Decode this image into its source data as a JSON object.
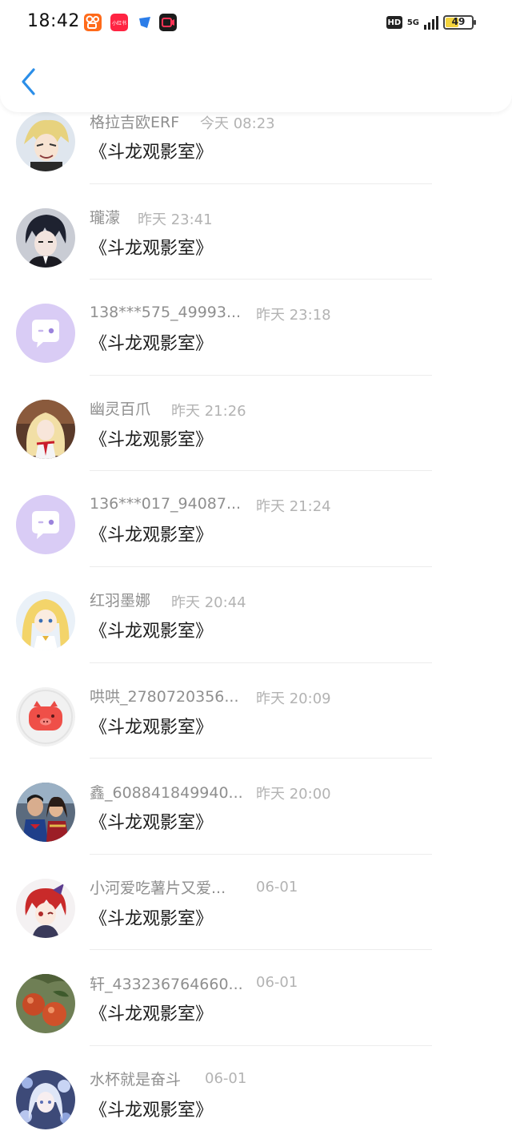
{
  "status_bar": {
    "time": "18:42",
    "network": "5G",
    "hd": "HD",
    "battery": "49",
    "battery_level": 0.49,
    "app_icons": [
      "kuaishou-app-icon",
      "xiaohongshu-app-icon",
      "feishu-app-icon",
      "video-app-icon"
    ],
    "app_badge_text": "小红书"
  },
  "header": {
    "back_icon": "chevron-left-icon",
    "accent_color": "#2b8ee8"
  },
  "messages": [
    {
      "name": "格拉吉欧ERF",
      "time": "今天 08:23",
      "text": "《斗龙观影室》",
      "avatar": "anime-blond-boy-avatar"
    },
    {
      "name": "瓏濛",
      "time": "昨天 23:41",
      "text": "《斗龙观影室》",
      "avatar": "anime-dark-hair-boy-avatar"
    },
    {
      "name": "138***575_49993...",
      "time": "昨天 23:18",
      "text": "《斗龙观影室》",
      "avatar": "default-chat-bubble-avatar"
    },
    {
      "name": "幽灵百爪",
      "time": "昨天 21:26",
      "text": "《斗龙观影室》",
      "avatar": "anime-girl-red-tie-avatar"
    },
    {
      "name": "136***017_94087...",
      "time": "昨天 21:24",
      "text": "《斗龙观影室》",
      "avatar": "default-chat-bubble-avatar"
    },
    {
      "name": "红羽墨娜",
      "time": "昨天 20:44",
      "text": "《斗龙观影室》",
      "avatar": "anime-blonde-girl-avatar"
    },
    {
      "name": "哄哄_2780720356...",
      "time": "昨天 20:09",
      "text": "《斗龙观影室》",
      "avatar": "red-pig-avatar"
    },
    {
      "name": "鑫_608841849940...",
      "time": "昨天 20:00",
      "text": "《斗龙观影室》",
      "avatar": "superheroes-avatar"
    },
    {
      "name": "小河爱吃薯片又爱...",
      "time": "06-01",
      "text": "《斗龙观影室》",
      "avatar": "anime-red-hair-avatar"
    },
    {
      "name": "轩_433236764660...",
      "time": "06-01",
      "text": "《斗龙观影室》",
      "avatar": "pomegranates-avatar"
    },
    {
      "name": "水杯就是奋斗",
      "time": "06-01",
      "text": "《斗龙观影室》",
      "avatar": "anime-blue-floral-avatar"
    }
  ]
}
